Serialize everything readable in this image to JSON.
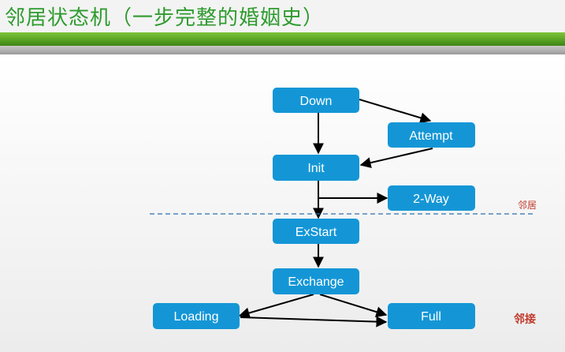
{
  "title": "邻居状态机（一步完整的婚姻史）",
  "colors": {
    "node": "#1496d6",
    "title": "#2e9b2e",
    "accent": "#c0392b"
  },
  "states": {
    "down": "Down",
    "attempt": "Attempt",
    "init": "Init",
    "two_way": "2-Way",
    "exstart": "ExStart",
    "exchange": "Exchange",
    "loading": "Loading",
    "full": "Full"
  },
  "annotations": {
    "neighbor": "邻居",
    "adjacency": "邻接"
  }
}
